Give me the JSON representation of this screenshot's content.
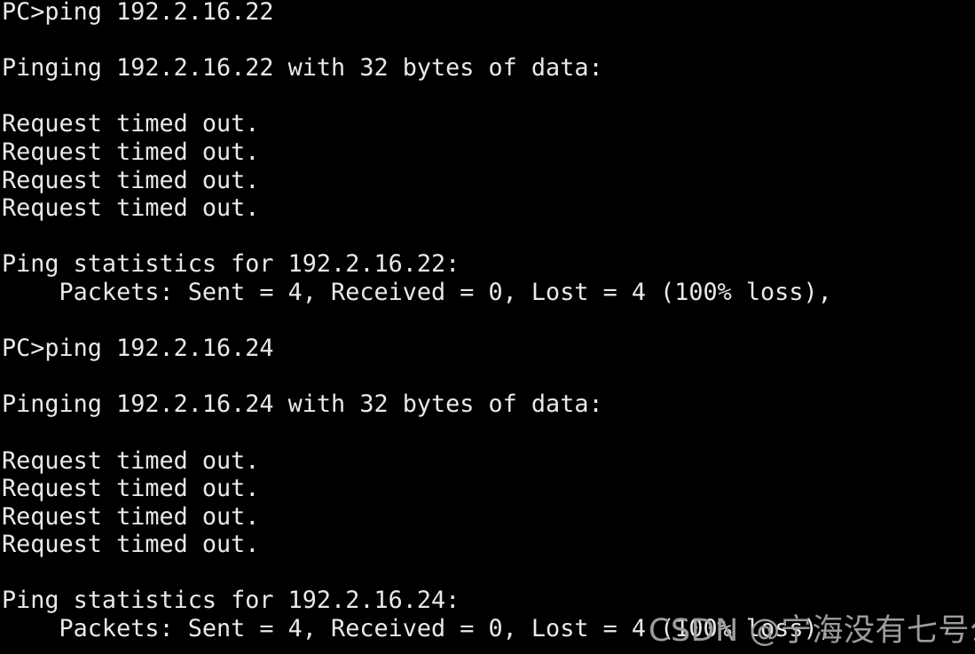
{
  "terminal": {
    "background_color": "#000000",
    "text_color": "#e9e9e9",
    "lines": [
      "PC>ping 192.2.16.22",
      "",
      "Pinging 192.2.16.22 with 32 bytes of data:",
      "",
      "Request timed out.",
      "Request timed out.",
      "Request timed out.",
      "Request timed out.",
      "",
      "Ping statistics for 192.2.16.22:",
      "    Packets: Sent = 4, Received = 0, Lost = 4 (100% loss),",
      "",
      "PC>ping 192.2.16.24",
      "",
      "Pinging 192.2.16.24 with 32 bytes of data:",
      "",
      "Request timed out.",
      "Request timed out.",
      "Request timed out.",
      "Request timed out.",
      "",
      "Ping statistics for 192.2.16.24:",
      "    Packets: Sent = 4, Received = 0, Lost = 4 (100% loss),"
    ]
  },
  "watermark": {
    "text": "CSDN @宁海没有七号公园",
    "color": "#9d9d9d"
  }
}
